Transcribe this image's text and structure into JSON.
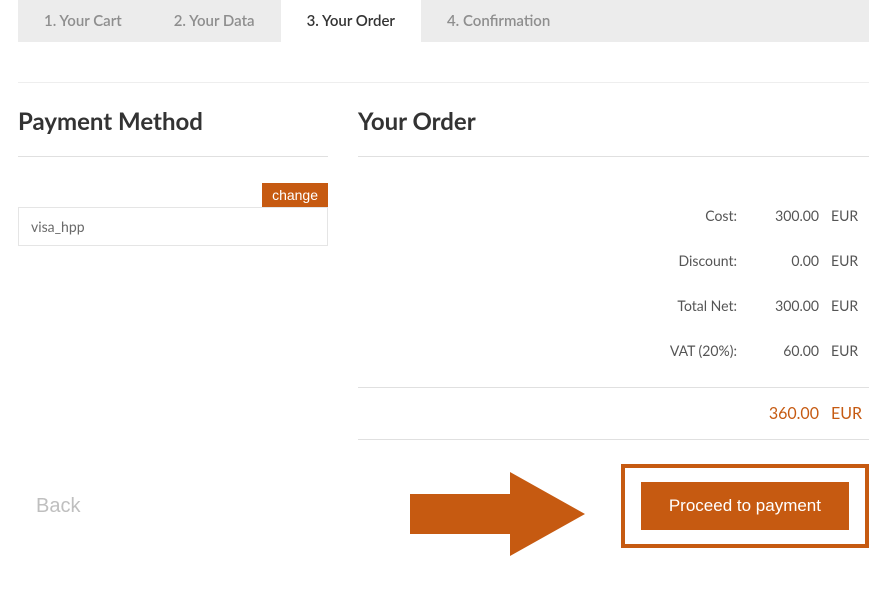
{
  "tabs": [
    {
      "label": "1. Your Cart"
    },
    {
      "label": "2. Your Data"
    },
    {
      "label": "3. Your Order"
    },
    {
      "label": "4. Confirmation"
    }
  ],
  "payment": {
    "heading": "Payment Method",
    "change_label": "change",
    "method": "visa_hpp"
  },
  "order": {
    "heading": "Your Order",
    "rows": [
      {
        "label": "Cost:",
        "value": "300.00",
        "currency": "EUR"
      },
      {
        "label": "Discount:",
        "value": "0.00",
        "currency": "EUR"
      },
      {
        "label": "Total Net:",
        "value": "300.00",
        "currency": "EUR"
      },
      {
        "label": "VAT (20%):",
        "value": "60.00",
        "currency": "EUR"
      }
    ],
    "total": {
      "value": "360.00",
      "currency": "EUR"
    }
  },
  "footer": {
    "back_label": "Back",
    "proceed_label": "Proceed to payment"
  }
}
